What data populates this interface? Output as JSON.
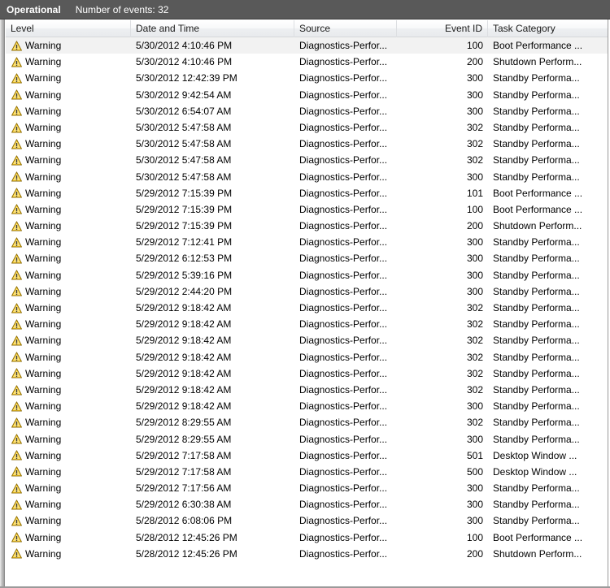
{
  "window": {
    "log_name": "Operational",
    "events_count_label": "Number of events: 32",
    "accent_bar_color": "#595959",
    "selected_row_color": "#f2f2f2"
  },
  "table": {
    "columns": [
      {
        "key": "level",
        "label": "Level",
        "align": "left"
      },
      {
        "key": "datetime",
        "label": "Date and Time",
        "align": "left"
      },
      {
        "key": "source",
        "label": "Source",
        "align": "left"
      },
      {
        "key": "event_id",
        "label": "Event ID",
        "align": "right"
      },
      {
        "key": "task_category",
        "label": "Task Category",
        "align": "left"
      }
    ],
    "row_count": 32,
    "selected_index": 0,
    "rows": [
      {
        "level": "Warning",
        "icon": "warning-icon",
        "datetime": "5/30/2012 4:10:46 PM",
        "source": "Diagnostics-Perfor...",
        "event_id": "100",
        "task_category": "Boot Performance ..."
      },
      {
        "level": "Warning",
        "icon": "warning-icon",
        "datetime": "5/30/2012 4:10:46 PM",
        "source": "Diagnostics-Perfor...",
        "event_id": "200",
        "task_category": "Shutdown Perform..."
      },
      {
        "level": "Warning",
        "icon": "warning-icon",
        "datetime": "5/30/2012 12:42:39 PM",
        "source": "Diagnostics-Perfor...",
        "event_id": "300",
        "task_category": "Standby Performa..."
      },
      {
        "level": "Warning",
        "icon": "warning-icon",
        "datetime": "5/30/2012 9:42:54 AM",
        "source": "Diagnostics-Perfor...",
        "event_id": "300",
        "task_category": "Standby Performa..."
      },
      {
        "level": "Warning",
        "icon": "warning-icon",
        "datetime": "5/30/2012 6:54:07 AM",
        "source": "Diagnostics-Perfor...",
        "event_id": "300",
        "task_category": "Standby Performa..."
      },
      {
        "level": "Warning",
        "icon": "warning-icon",
        "datetime": "5/30/2012 5:47:58 AM",
        "source": "Diagnostics-Perfor...",
        "event_id": "302",
        "task_category": "Standby Performa..."
      },
      {
        "level": "Warning",
        "icon": "warning-icon",
        "datetime": "5/30/2012 5:47:58 AM",
        "source": "Diagnostics-Perfor...",
        "event_id": "302",
        "task_category": "Standby Performa..."
      },
      {
        "level": "Warning",
        "icon": "warning-icon",
        "datetime": "5/30/2012 5:47:58 AM",
        "source": "Diagnostics-Perfor...",
        "event_id": "302",
        "task_category": "Standby Performa..."
      },
      {
        "level": "Warning",
        "icon": "warning-icon",
        "datetime": "5/30/2012 5:47:58 AM",
        "source": "Diagnostics-Perfor...",
        "event_id": "300",
        "task_category": "Standby Performa..."
      },
      {
        "level": "Warning",
        "icon": "warning-icon",
        "datetime": "5/29/2012 7:15:39 PM",
        "source": "Diagnostics-Perfor...",
        "event_id": "101",
        "task_category": "Boot Performance ..."
      },
      {
        "level": "Warning",
        "icon": "warning-icon",
        "datetime": "5/29/2012 7:15:39 PM",
        "source": "Diagnostics-Perfor...",
        "event_id": "100",
        "task_category": "Boot Performance ..."
      },
      {
        "level": "Warning",
        "icon": "warning-icon",
        "datetime": "5/29/2012 7:15:39 PM",
        "source": "Diagnostics-Perfor...",
        "event_id": "200",
        "task_category": "Shutdown Perform..."
      },
      {
        "level": "Warning",
        "icon": "warning-icon",
        "datetime": "5/29/2012 7:12:41 PM",
        "source": "Diagnostics-Perfor...",
        "event_id": "300",
        "task_category": "Standby Performa..."
      },
      {
        "level": "Warning",
        "icon": "warning-icon",
        "datetime": "5/29/2012 6:12:53 PM",
        "source": "Diagnostics-Perfor...",
        "event_id": "300",
        "task_category": "Standby Performa..."
      },
      {
        "level": "Warning",
        "icon": "warning-icon",
        "datetime": "5/29/2012 5:39:16 PM",
        "source": "Diagnostics-Perfor...",
        "event_id": "300",
        "task_category": "Standby Performa..."
      },
      {
        "level": "Warning",
        "icon": "warning-icon",
        "datetime": "5/29/2012 2:44:20 PM",
        "source": "Diagnostics-Perfor...",
        "event_id": "300",
        "task_category": "Standby Performa..."
      },
      {
        "level": "Warning",
        "icon": "warning-icon",
        "datetime": "5/29/2012 9:18:42 AM",
        "source": "Diagnostics-Perfor...",
        "event_id": "302",
        "task_category": "Standby Performa..."
      },
      {
        "level": "Warning",
        "icon": "warning-icon",
        "datetime": "5/29/2012 9:18:42 AM",
        "source": "Diagnostics-Perfor...",
        "event_id": "302",
        "task_category": "Standby Performa..."
      },
      {
        "level": "Warning",
        "icon": "warning-icon",
        "datetime": "5/29/2012 9:18:42 AM",
        "source": "Diagnostics-Perfor...",
        "event_id": "302",
        "task_category": "Standby Performa..."
      },
      {
        "level": "Warning",
        "icon": "warning-icon",
        "datetime": "5/29/2012 9:18:42 AM",
        "source": "Diagnostics-Perfor...",
        "event_id": "302",
        "task_category": "Standby Performa..."
      },
      {
        "level": "Warning",
        "icon": "warning-icon",
        "datetime": "5/29/2012 9:18:42 AM",
        "source": "Diagnostics-Perfor...",
        "event_id": "302",
        "task_category": "Standby Performa..."
      },
      {
        "level": "Warning",
        "icon": "warning-icon",
        "datetime": "5/29/2012 9:18:42 AM",
        "source": "Diagnostics-Perfor...",
        "event_id": "302",
        "task_category": "Standby Performa..."
      },
      {
        "level": "Warning",
        "icon": "warning-icon",
        "datetime": "5/29/2012 9:18:42 AM",
        "source": "Diagnostics-Perfor...",
        "event_id": "300",
        "task_category": "Standby Performa..."
      },
      {
        "level": "Warning",
        "icon": "warning-icon",
        "datetime": "5/29/2012 8:29:55 AM",
        "source": "Diagnostics-Perfor...",
        "event_id": "302",
        "task_category": "Standby Performa..."
      },
      {
        "level": "Warning",
        "icon": "warning-icon",
        "datetime": "5/29/2012 8:29:55 AM",
        "source": "Diagnostics-Perfor...",
        "event_id": "300",
        "task_category": "Standby Performa..."
      },
      {
        "level": "Warning",
        "icon": "warning-icon",
        "datetime": "5/29/2012 7:17:58 AM",
        "source": "Diagnostics-Perfor...",
        "event_id": "501",
        "task_category": "Desktop Window ..."
      },
      {
        "level": "Warning",
        "icon": "warning-icon",
        "datetime": "5/29/2012 7:17:58 AM",
        "source": "Diagnostics-Perfor...",
        "event_id": "500",
        "task_category": "Desktop Window ..."
      },
      {
        "level": "Warning",
        "icon": "warning-icon",
        "datetime": "5/29/2012 7:17:56 AM",
        "source": "Diagnostics-Perfor...",
        "event_id": "300",
        "task_category": "Standby Performa..."
      },
      {
        "level": "Warning",
        "icon": "warning-icon",
        "datetime": "5/29/2012 6:30:38 AM",
        "source": "Diagnostics-Perfor...",
        "event_id": "300",
        "task_category": "Standby Performa..."
      },
      {
        "level": "Warning",
        "icon": "warning-icon",
        "datetime": "5/28/2012 6:08:06 PM",
        "source": "Diagnostics-Perfor...",
        "event_id": "300",
        "task_category": "Standby Performa..."
      },
      {
        "level": "Warning",
        "icon": "warning-icon",
        "datetime": "5/28/2012 12:45:26 PM",
        "source": "Diagnostics-Perfor...",
        "event_id": "100",
        "task_category": "Boot Performance ..."
      },
      {
        "level": "Warning",
        "icon": "warning-icon",
        "datetime": "5/28/2012 12:45:26 PM",
        "source": "Diagnostics-Perfor...",
        "event_id": "200",
        "task_category": "Shutdown Perform..."
      }
    ]
  }
}
